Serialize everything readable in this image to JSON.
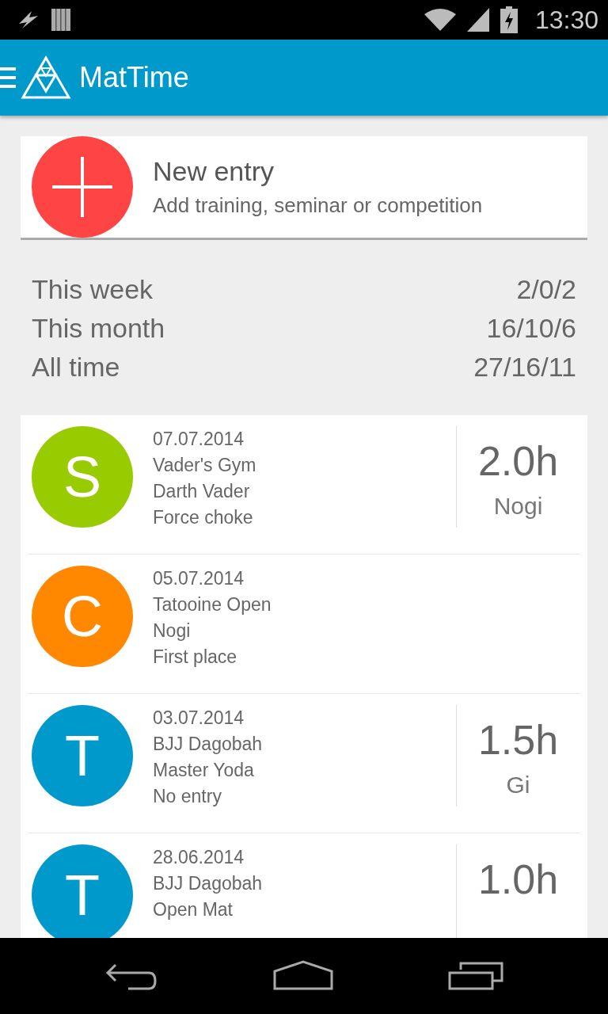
{
  "status_bar": {
    "time": "13:30"
  },
  "app_bar": {
    "title": "MatTime"
  },
  "new_entry": {
    "title": "New entry",
    "subtitle": "Add training, seminar or competition"
  },
  "stats": [
    {
      "label": "This week",
      "value": "2/0/2"
    },
    {
      "label": "This month",
      "value": "16/10/6"
    },
    {
      "label": "All time",
      "value": "27/16/11"
    }
  ],
  "entries": [
    {
      "letter": "S",
      "color": "#99cc00",
      "lines": [
        "07.07.2014",
        "Vader's Gym",
        "Darth Vader",
        "Force choke"
      ],
      "hours": "2.0h",
      "type": "Nogi"
    },
    {
      "letter": "C",
      "color": "#ff8800",
      "lines": [
        "05.07.2014",
        "Tatooine Open",
        "Nogi",
        "First place"
      ]
    },
    {
      "letter": "T",
      "color": "#0099cc",
      "lines": [
        "03.07.2014",
        "BJJ Dagobah",
        "Master Yoda",
        "No entry"
      ],
      "hours": "1.5h",
      "type": "Gi"
    },
    {
      "letter": "T",
      "color": "#0099cc",
      "lines": [
        "28.06.2014",
        "BJJ Dagobah",
        "Open Mat"
      ],
      "hours": "1.0h"
    }
  ]
}
